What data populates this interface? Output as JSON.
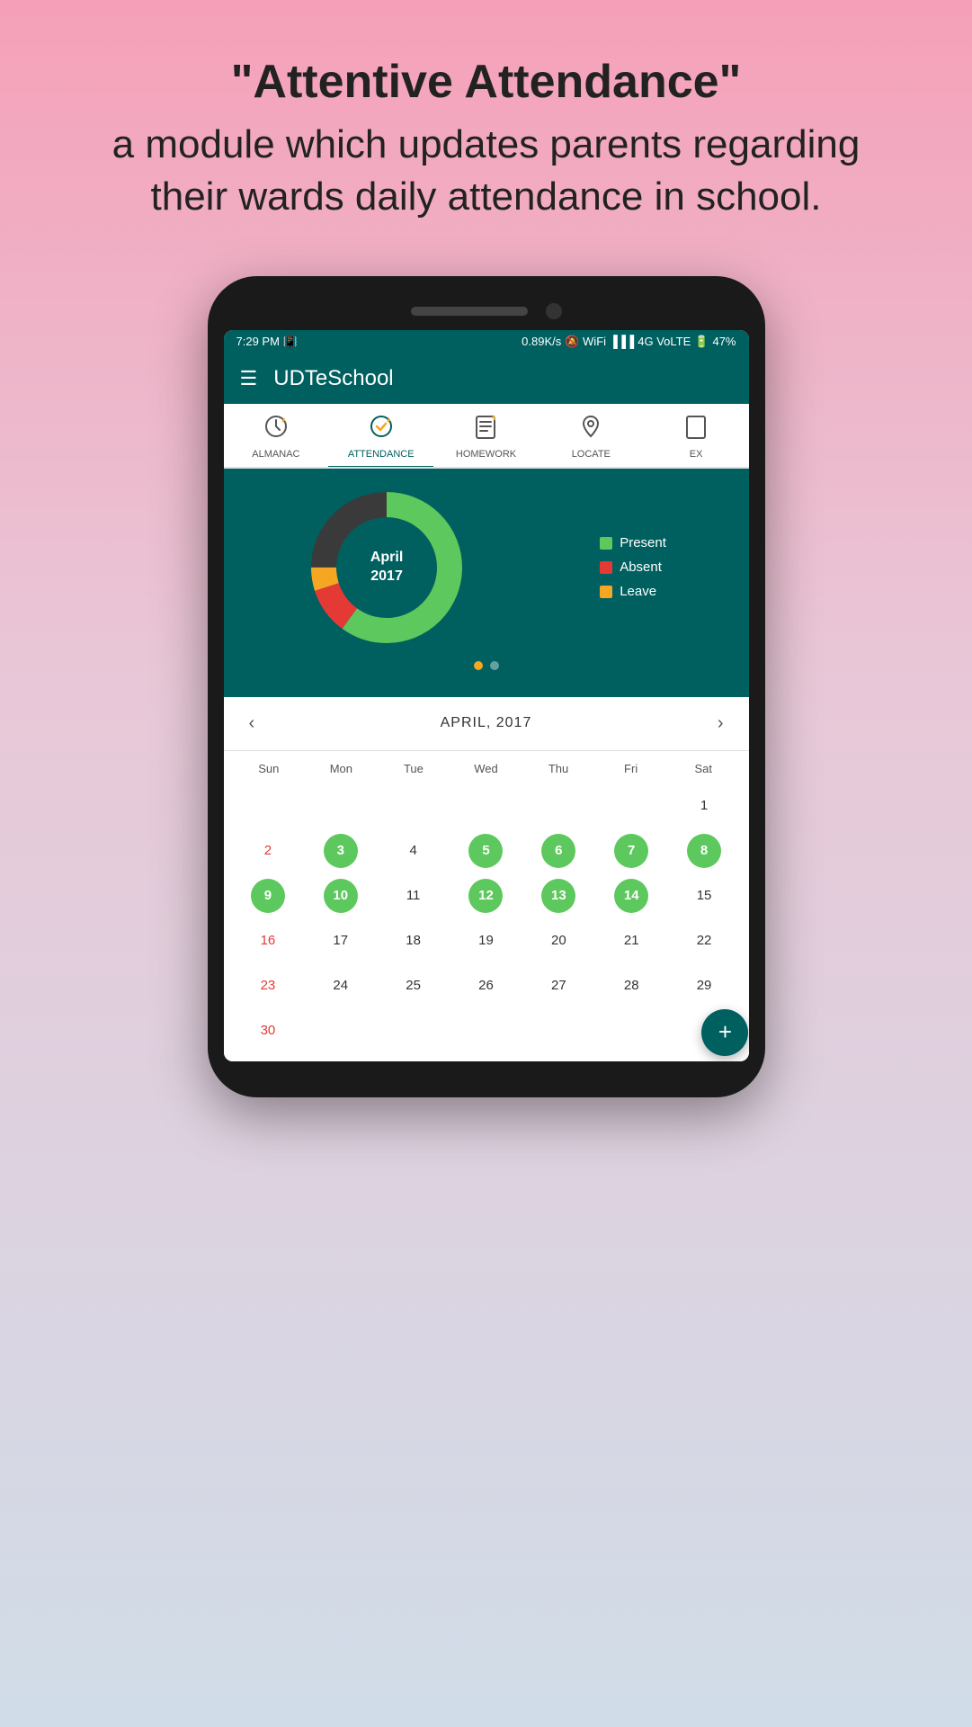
{
  "header": {
    "title_line1": "\"Attentive Attendance\"",
    "title_line2": "a module which updates parents regarding their wards daily attendance in school."
  },
  "statusBar": {
    "time": "7:29 PM",
    "network": "0.89K/s",
    "signal": "4G VoLTE",
    "battery": "47%"
  },
  "app": {
    "title": "UDTeSchool"
  },
  "tabs": [
    {
      "id": "almanac",
      "label": "ALMANAC",
      "active": false
    },
    {
      "id": "attendance",
      "label": "ATTENDANCE",
      "active": true
    },
    {
      "id": "homework",
      "label": "HOMEWORK",
      "active": false
    },
    {
      "id": "locate",
      "label": "LOCATE",
      "active": false
    },
    {
      "id": "ex",
      "label": "EX",
      "active": false
    }
  ],
  "chart": {
    "month": "April",
    "year": "2017",
    "legend": {
      "present": "Present",
      "absent": "Absent",
      "leave": "Leave"
    }
  },
  "calendar": {
    "title": "APRIL, 2017",
    "dayHeaders": [
      "Sun",
      "Mon",
      "Tue",
      "Wed",
      "Thu",
      "Fri",
      "Sat"
    ],
    "prevLabel": "‹",
    "nextLabel": "›"
  },
  "fab": {
    "label": "+"
  }
}
